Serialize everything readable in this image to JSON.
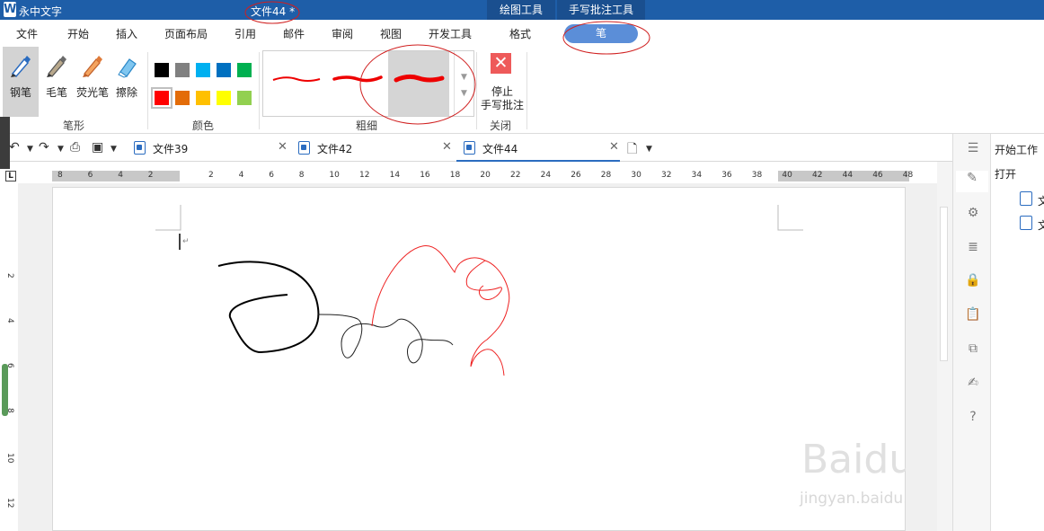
{
  "titlebar": {
    "app_name": "永中文字",
    "doc_title": "文件44 *",
    "context_tabs": [
      "绘图工具",
      "手写批注工具"
    ]
  },
  "menu": {
    "items": [
      "文件",
      "开始",
      "插入",
      "页面布局",
      "引用",
      "邮件",
      "审阅",
      "视图",
      "开发工具",
      "格式"
    ],
    "active": "笔"
  },
  "ribbon": {
    "pen_tools": [
      "钢笔",
      "毛笔",
      "荧光笔",
      "擦除"
    ],
    "pen_group_label": "笔形",
    "color_group_label": "颜色",
    "colors_row1": [
      "#000000",
      "#808080",
      "#00b0f0",
      "#0070c0",
      "#00b050"
    ],
    "colors_row2": [
      "#ff0000",
      "#e36c09",
      "#ffc000",
      "#ffff00",
      "#92d050"
    ],
    "thickness_group_label": "粗细",
    "stop_label_1": "停止",
    "stop_label_2": "手写批注",
    "close_group_label": "关闭"
  },
  "doc_tabs": [
    "文件39",
    "文件42",
    "文件44"
  ],
  "ruler": {
    "h_ticks": [
      "8",
      "6",
      "4",
      "2",
      "",
      "2",
      "4",
      "6",
      "8",
      "10",
      "12",
      "14",
      "16",
      "18",
      "20",
      "22",
      "24",
      "26",
      "28",
      "30",
      "32",
      "34",
      "36",
      "38",
      "40",
      "42",
      "44",
      "46",
      "48"
    ],
    "v_ticks": [
      "2",
      "4",
      "6",
      "8",
      "10",
      "12"
    ],
    "corner": "L"
  },
  "right_panel": {
    "title": "开始工作",
    "open_label": "打开",
    "recent_files": [
      "文",
      "文"
    ]
  },
  "watermark": {
    "brand": "Baidu经验",
    "url": "jingyan.baidu.com"
  }
}
